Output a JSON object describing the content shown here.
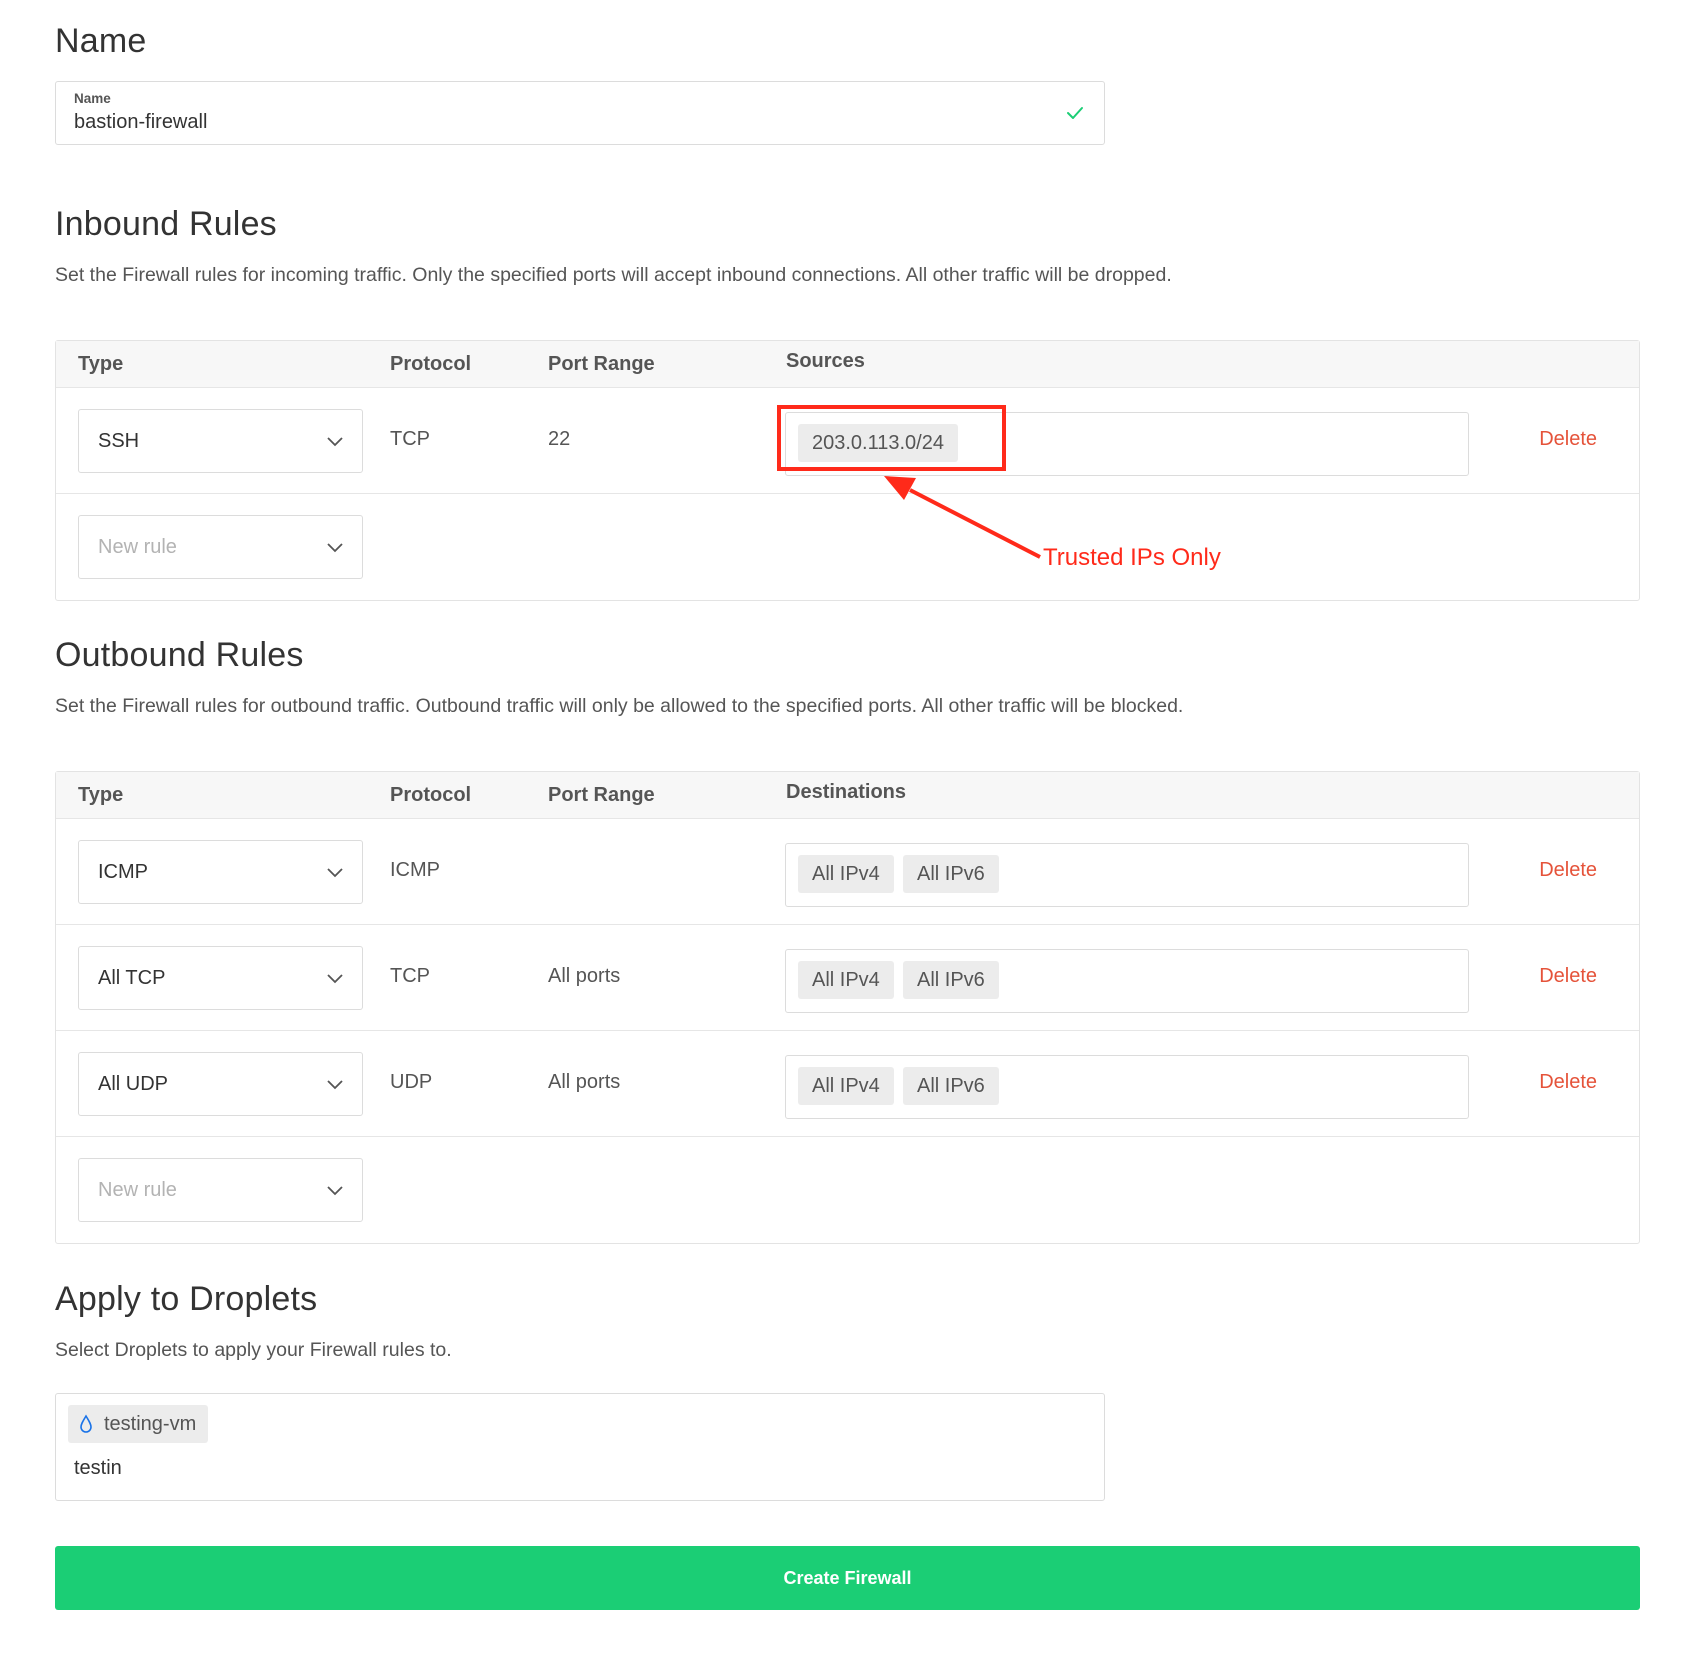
{
  "name_section": {
    "title": "Name",
    "field_label": "Name",
    "field_value": "bastion-firewall"
  },
  "inbound": {
    "title": "Inbound Rules",
    "description": "Set the Firewall rules for incoming traffic. Only the specified ports will accept inbound connections. All other traffic will be dropped.",
    "headers": {
      "type": "Type",
      "protocol": "Protocol",
      "port_range": "Port Range",
      "targets": "Sources"
    },
    "rules": [
      {
        "type": "SSH",
        "protocol": "TCP",
        "port_range": "22",
        "tags": [
          "203.0.113.0/24"
        ],
        "delete_label": "Delete"
      }
    ],
    "new_rule_placeholder": "New rule"
  },
  "annotation": {
    "text": "Trusted IPs Only",
    "color": "#ff2a1a"
  },
  "outbound": {
    "title": "Outbound Rules",
    "description": "Set the Firewall rules for outbound traffic. Outbound traffic will only be allowed to the specified ports. All other traffic will be blocked.",
    "headers": {
      "type": "Type",
      "protocol": "Protocol",
      "port_range": "Port Range",
      "targets": "Destinations"
    },
    "rules": [
      {
        "type": "ICMP",
        "protocol": "ICMP",
        "port_range": "",
        "tags": [
          "All IPv4",
          "All IPv6"
        ],
        "delete_label": "Delete"
      },
      {
        "type": "All TCP",
        "protocol": "TCP",
        "port_range": "All ports",
        "tags": [
          "All IPv4",
          "All IPv6"
        ],
        "delete_label": "Delete"
      },
      {
        "type": "All UDP",
        "protocol": "UDP",
        "port_range": "All ports",
        "tags": [
          "All IPv4",
          "All IPv6"
        ],
        "delete_label": "Delete"
      }
    ],
    "new_rule_placeholder": "New rule"
  },
  "droplets": {
    "title": "Apply to Droplets",
    "description": "Select Droplets to apply your Firewall rules to.",
    "selected": [
      {
        "name": "testing-vm",
        "icon": "droplet-icon"
      }
    ],
    "input_value": "testin"
  },
  "create_button": {
    "label": "Create Firewall"
  },
  "colors": {
    "accent_green": "#1bce75",
    "delete_red": "#e5533a",
    "check_green": "#1bce75"
  }
}
